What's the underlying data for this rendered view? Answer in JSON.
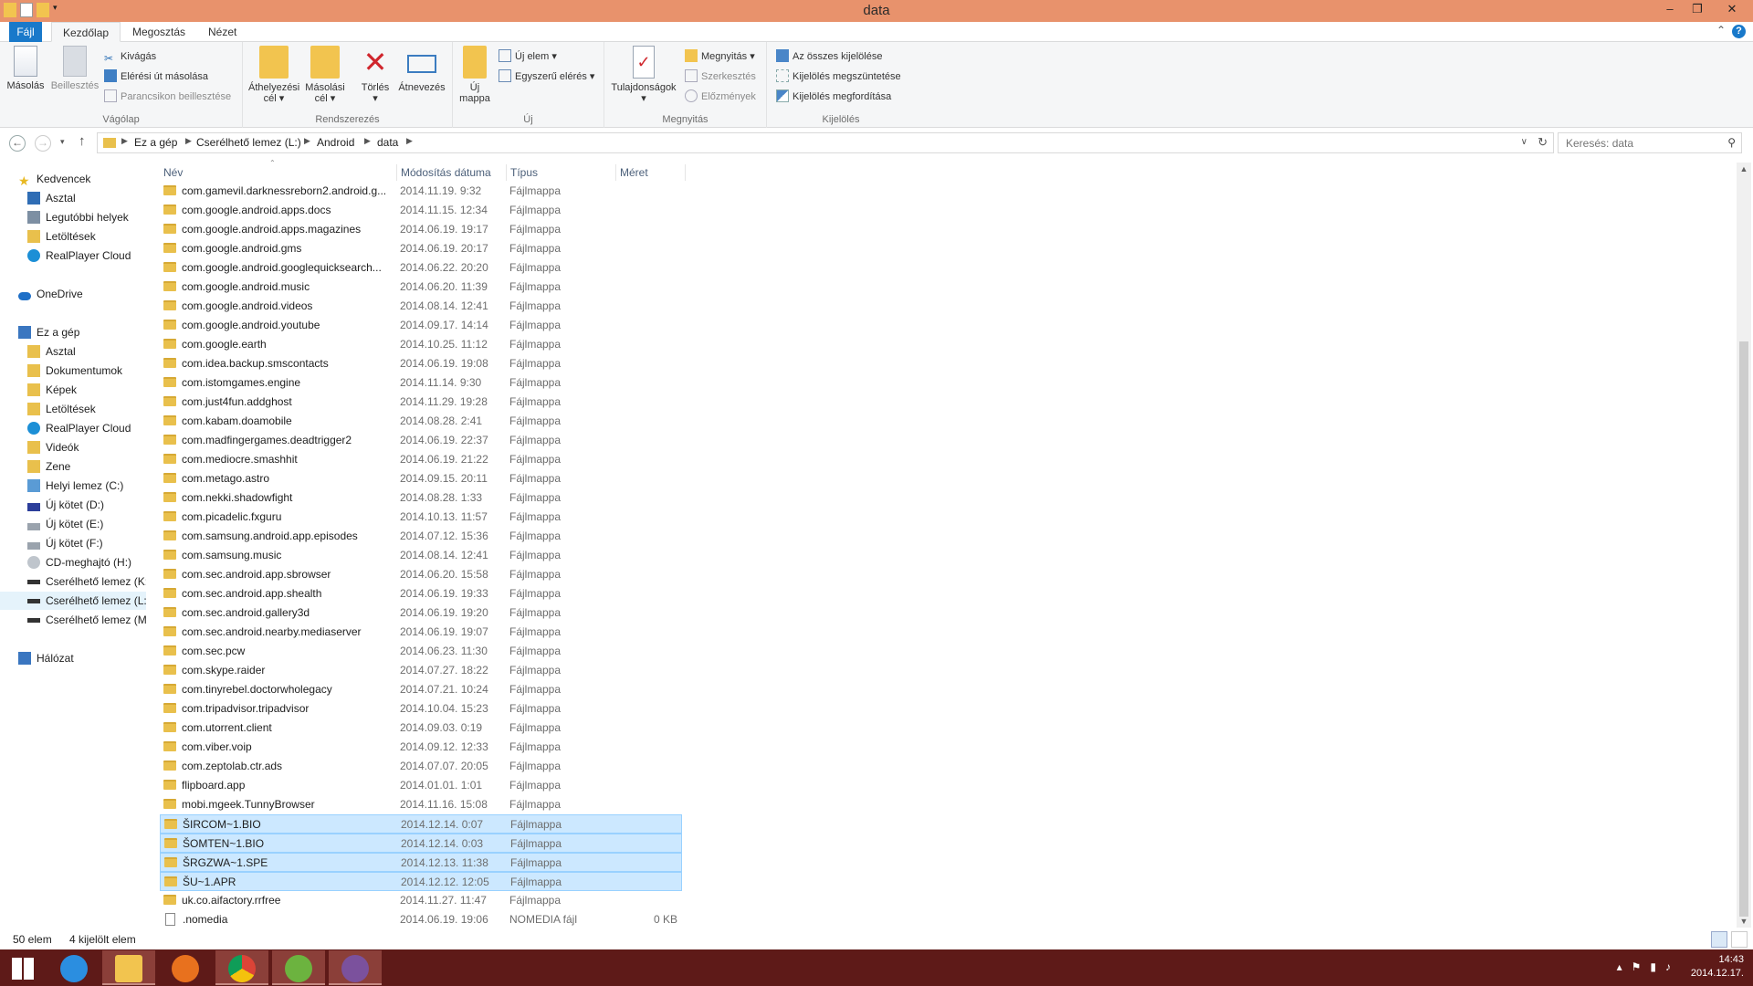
{
  "window": {
    "title": "data"
  },
  "ribbon": {
    "tabs": [
      "Fájl",
      "Kezdőlap",
      "Megosztás",
      "Nézet"
    ],
    "groups": {
      "clipboard": "Vágólap",
      "organize": "Rendszerezés",
      "new": "Új",
      "open": "Megnyitás",
      "select": "Kijelölés"
    },
    "buttons": {
      "copy": "Másolás",
      "paste": "Beillesztés",
      "cut": "Kivágás",
      "copy_path": "Elérési út másolása",
      "paste_shortcut": "Parancsikon beillesztése",
      "move_to_1": "Áthelyezési",
      "move_to_2": "cél",
      "copy_to_1": "Másolási",
      "copy_to_2": "cél",
      "delete": "Törlés",
      "rename": "Átnevezés",
      "new_folder_1": "Új",
      "new_folder_2": "mappa",
      "new_item": "Új elem",
      "easy_access": "Egyszerű elérés",
      "properties": "Tulajdonságok",
      "open": "Megnyitás",
      "edit": "Szerkesztés",
      "history": "Előzmények",
      "select_all": "Az összes kijelölése",
      "select_none": "Kijelölés megszüntetése",
      "invert_selection": "Kijelölés megfordítása"
    }
  },
  "address": {
    "crumbs": [
      "Ez a gép",
      "Cserélhető lemez (L:)",
      "Android",
      "data"
    ],
    "search_placeholder": "Keresés: data"
  },
  "nav": {
    "favorites": "Kedvencek",
    "fav_items": [
      "Asztal",
      "Legutóbbi helyek",
      "Letöltések",
      "RealPlayer Cloud"
    ],
    "onedrive": "OneDrive",
    "thispc": "Ez a gép",
    "pc_items": [
      "Asztal",
      "Dokumentumok",
      "Képek",
      "Letöltések",
      "RealPlayer Cloud",
      "Videók",
      "Zene",
      "Helyi lemez (C:)",
      "Új kötet (D:)",
      "Új kötet (E:)",
      "Új kötet (F:)",
      "CD-meghajtó (H:)",
      "Cserélhető lemez (K:",
      "Cserélhető lemez (L:",
      "Cserélhető lemez (M"
    ],
    "network": "Hálózat"
  },
  "columns": {
    "name": "Név",
    "date": "Módosítás dátuma",
    "type": "Típus",
    "size": "Méret"
  },
  "files": [
    {
      "name": "com.gamevil.darknessreborn2.android.g...",
      "date": "2014.11.19. 9:32",
      "type": "Fájlmappa",
      "size": "",
      "sel": false
    },
    {
      "name": "com.google.android.apps.docs",
      "date": "2014.11.15. 12:34",
      "type": "Fájlmappa",
      "size": "",
      "sel": false
    },
    {
      "name": "com.google.android.apps.magazines",
      "date": "2014.06.19. 19:17",
      "type": "Fájlmappa",
      "size": "",
      "sel": false
    },
    {
      "name": "com.google.android.gms",
      "date": "2014.06.19. 20:17",
      "type": "Fájlmappa",
      "size": "",
      "sel": false
    },
    {
      "name": "com.google.android.googlequicksearch...",
      "date": "2014.06.22. 20:20",
      "type": "Fájlmappa",
      "size": "",
      "sel": false
    },
    {
      "name": "com.google.android.music",
      "date": "2014.06.20. 11:39",
      "type": "Fájlmappa",
      "size": "",
      "sel": false
    },
    {
      "name": "com.google.android.videos",
      "date": "2014.08.14. 12:41",
      "type": "Fájlmappa",
      "size": "",
      "sel": false
    },
    {
      "name": "com.google.android.youtube",
      "date": "2014.09.17. 14:14",
      "type": "Fájlmappa",
      "size": "",
      "sel": false
    },
    {
      "name": "com.google.earth",
      "date": "2014.10.25. 11:12",
      "type": "Fájlmappa",
      "size": "",
      "sel": false
    },
    {
      "name": "com.idea.backup.smscontacts",
      "date": "2014.06.19. 19:08",
      "type": "Fájlmappa",
      "size": "",
      "sel": false
    },
    {
      "name": "com.istomgames.engine",
      "date": "2014.11.14. 9:30",
      "type": "Fájlmappa",
      "size": "",
      "sel": false
    },
    {
      "name": "com.just4fun.addghost",
      "date": "2014.11.29. 19:28",
      "type": "Fájlmappa",
      "size": "",
      "sel": false
    },
    {
      "name": "com.kabam.doamobile",
      "date": "2014.08.28. 2:41",
      "type": "Fájlmappa",
      "size": "",
      "sel": false
    },
    {
      "name": "com.madfingergames.deadtrigger2",
      "date": "2014.06.19. 22:37",
      "type": "Fájlmappa",
      "size": "",
      "sel": false
    },
    {
      "name": "com.mediocre.smashhit",
      "date": "2014.06.19. 21:22",
      "type": "Fájlmappa",
      "size": "",
      "sel": false
    },
    {
      "name": "com.metago.astro",
      "date": "2014.09.15. 20:11",
      "type": "Fájlmappa",
      "size": "",
      "sel": false
    },
    {
      "name": "com.nekki.shadowfight",
      "date": "2014.08.28. 1:33",
      "type": "Fájlmappa",
      "size": "",
      "sel": false
    },
    {
      "name": "com.picadelic.fxguru",
      "date": "2014.10.13. 11:57",
      "type": "Fájlmappa",
      "size": "",
      "sel": false
    },
    {
      "name": "com.samsung.android.app.episodes",
      "date": "2014.07.12. 15:36",
      "type": "Fájlmappa",
      "size": "",
      "sel": false
    },
    {
      "name": "com.samsung.music",
      "date": "2014.08.14. 12:41",
      "type": "Fájlmappa",
      "size": "",
      "sel": false
    },
    {
      "name": "com.sec.android.app.sbrowser",
      "date": "2014.06.20. 15:58",
      "type": "Fájlmappa",
      "size": "",
      "sel": false
    },
    {
      "name": "com.sec.android.app.shealth",
      "date": "2014.06.19. 19:33",
      "type": "Fájlmappa",
      "size": "",
      "sel": false
    },
    {
      "name": "com.sec.android.gallery3d",
      "date": "2014.06.19. 19:20",
      "type": "Fájlmappa",
      "size": "",
      "sel": false
    },
    {
      "name": "com.sec.android.nearby.mediaserver",
      "date": "2014.06.19. 19:07",
      "type": "Fájlmappa",
      "size": "",
      "sel": false
    },
    {
      "name": "com.sec.pcw",
      "date": "2014.06.23. 11:30",
      "type": "Fájlmappa",
      "size": "",
      "sel": false
    },
    {
      "name": "com.skype.raider",
      "date": "2014.07.27. 18:22",
      "type": "Fájlmappa",
      "size": "",
      "sel": false
    },
    {
      "name": "com.tinyrebel.doctorwholegacy",
      "date": "2014.07.21. 10:24",
      "type": "Fájlmappa",
      "size": "",
      "sel": false
    },
    {
      "name": "com.tripadvisor.tripadvisor",
      "date": "2014.10.04. 15:23",
      "type": "Fájlmappa",
      "size": "",
      "sel": false
    },
    {
      "name": "com.utorrent.client",
      "date": "2014.09.03. 0:19",
      "type": "Fájlmappa",
      "size": "",
      "sel": false
    },
    {
      "name": "com.viber.voip",
      "date": "2014.09.12. 12:33",
      "type": "Fájlmappa",
      "size": "",
      "sel": false
    },
    {
      "name": "com.zeptolab.ctr.ads",
      "date": "2014.07.07. 20:05",
      "type": "Fájlmappa",
      "size": "",
      "sel": false
    },
    {
      "name": "flipboard.app",
      "date": "2014.01.01. 1:01",
      "type": "Fájlmappa",
      "size": "",
      "sel": false
    },
    {
      "name": "mobi.mgeek.TunnyBrowser",
      "date": "2014.11.16. 15:08",
      "type": "Fájlmappa",
      "size": "",
      "sel": false
    },
    {
      "name": "ŠIRCOM~1.BIO",
      "date": "2014.12.14. 0:07",
      "type": "Fájlmappa",
      "size": "",
      "sel": true
    },
    {
      "name": "ŠOMTEN~1.BIO",
      "date": "2014.12.14. 0:03",
      "type": "Fájlmappa",
      "size": "",
      "sel": true
    },
    {
      "name": "ŠRGZWA~1.SPE",
      "date": "2014.12.13. 11:38",
      "type": "Fájlmappa",
      "size": "",
      "sel": true
    },
    {
      "name": "ŠU~1.APR",
      "date": "2014.12.12. 12:05",
      "type": "Fájlmappa",
      "size": "",
      "sel": true
    },
    {
      "name": "uk.co.aifactory.rrfree",
      "date": "2014.11.27. 11:47",
      "type": "Fájlmappa",
      "size": "",
      "sel": false
    },
    {
      "name": ".nomedia",
      "date": "2014.06.19. 19:06",
      "type": "NOMEDIA fájl",
      "size": "0 KB",
      "sel": false,
      "file": true
    }
  ],
  "status": {
    "count": "50 elem",
    "selected": "4 kijelölt elem"
  },
  "taskbar": {
    "time": "14:43",
    "date": "2014.12.17."
  },
  "colors": {
    "titlebar": "#e8926c",
    "taskbar": "#5e1a18",
    "accent": "#1979ca",
    "selection": "#cce8ff"
  }
}
